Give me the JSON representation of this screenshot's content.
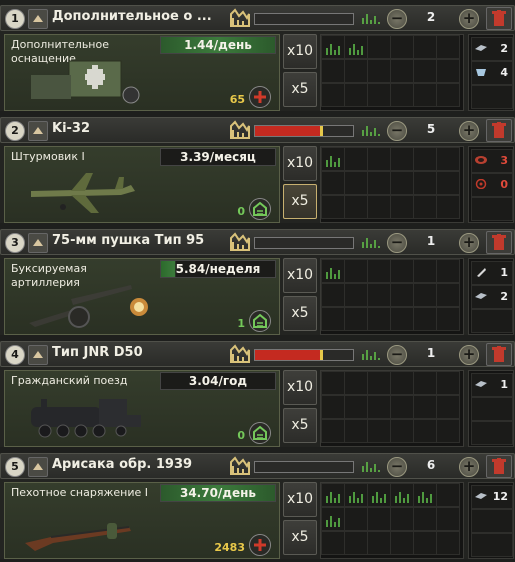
{
  "entries": [
    {
      "number": "1",
      "title": "Дополнительное о ...",
      "factory_count": "2",
      "equipment_name": "Дополнительное\nоснащение",
      "rate": "1.44/день",
      "rate_style": "green",
      "stock": "65",
      "stock_style": "yellow",
      "efficiency_percent": 0,
      "multiplier_labels": [
        "x10",
        "x5"
      ],
      "active_multiplier": "",
      "resources": [
        {
          "icon": "steel-icon",
          "amount": "2",
          "style": "white"
        },
        {
          "icon": "aluminium-icon",
          "amount": "4",
          "style": "white"
        }
      ]
    },
    {
      "number": "2",
      "title": "Ki-32",
      "factory_count": "5",
      "equipment_name": "Штурмовик I",
      "rate": "3.39/месяц",
      "rate_style": "dark",
      "stock": "0",
      "stock_style": "green",
      "efficiency_percent": 66,
      "multiplier_labels": [
        "x10",
        "x5"
      ],
      "active_multiplier": "x5",
      "resources": [
        {
          "icon": "rubber-icon",
          "amount": "3",
          "style": "red"
        },
        {
          "icon": "chromium-icon",
          "amount": "0",
          "style": "red"
        }
      ]
    },
    {
      "number": "3",
      "title": "75-мм пушка Тип 95",
      "factory_count": "1",
      "equipment_name": "Буксируемая\nартиллерия",
      "rate": "5.84/неделя",
      "rate_style": "half",
      "stock": "1",
      "stock_style": "green",
      "efficiency_percent": 0,
      "multiplier_labels": [
        "x10",
        "x5"
      ],
      "active_multiplier": "",
      "resources": [
        {
          "icon": "tungsten-icon",
          "amount": "1",
          "style": "white"
        },
        {
          "icon": "steel-icon",
          "amount": "2",
          "style": "white"
        }
      ]
    },
    {
      "number": "4",
      "title": "Тип JNR D50",
      "factory_count": "1",
      "equipment_name": "Гражданский поезд",
      "rate": "3.04/год",
      "rate_style": "dark",
      "stock": "0",
      "stock_style": "green",
      "efficiency_percent": 66,
      "multiplier_labels": [
        "x10",
        "x5"
      ],
      "active_multiplier": "",
      "resources": [
        {
          "icon": "steel-icon",
          "amount": "1",
          "style": "white"
        }
      ]
    },
    {
      "number": "5",
      "title": "Арисака обр. 1939",
      "factory_count": "6",
      "equipment_name": "Пехотное снаряжение I",
      "rate": "34.70/день",
      "rate_style": "green",
      "stock": "2483",
      "stock_style": "yellow",
      "efficiency_percent": 0,
      "multiplier_labels": [
        "x10",
        "x5"
      ],
      "active_multiplier": "",
      "resources": [
        {
          "icon": "steel-icon",
          "amount": "12",
          "style": "white"
        }
      ]
    }
  ]
}
